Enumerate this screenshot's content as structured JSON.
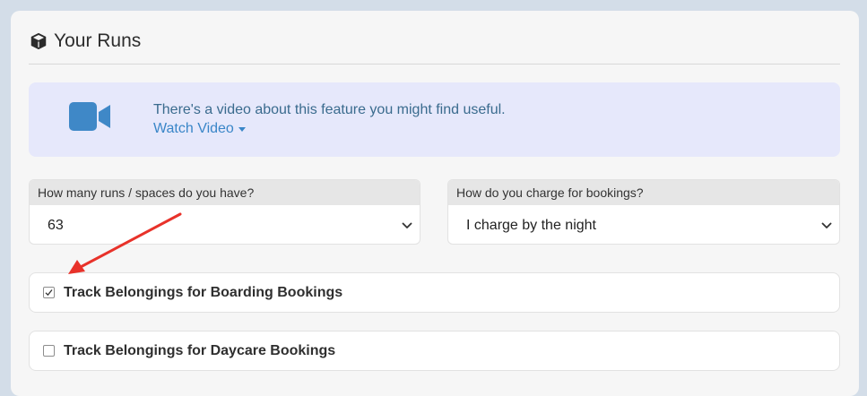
{
  "header": {
    "title": "Your Runs",
    "icon": "cube-icon"
  },
  "banner": {
    "message": "There's a video about this feature you might find useful.",
    "link_label": "Watch Video",
    "icon": "video-camera-icon",
    "accent": "#3a86c8"
  },
  "runs_field": {
    "label": "How many runs / spaces do you have?",
    "value": "63"
  },
  "charge_field": {
    "label": "How do you charge for bookings?",
    "value": "I charge by the night"
  },
  "options": [
    {
      "label": "Track Belongings for Boarding Bookings",
      "checked": true
    },
    {
      "label": "Track Belongings for Daycare Bookings",
      "checked": false
    }
  ],
  "annotation": {
    "icon": "red-arrow-annotation",
    "color": "#e8322a"
  }
}
